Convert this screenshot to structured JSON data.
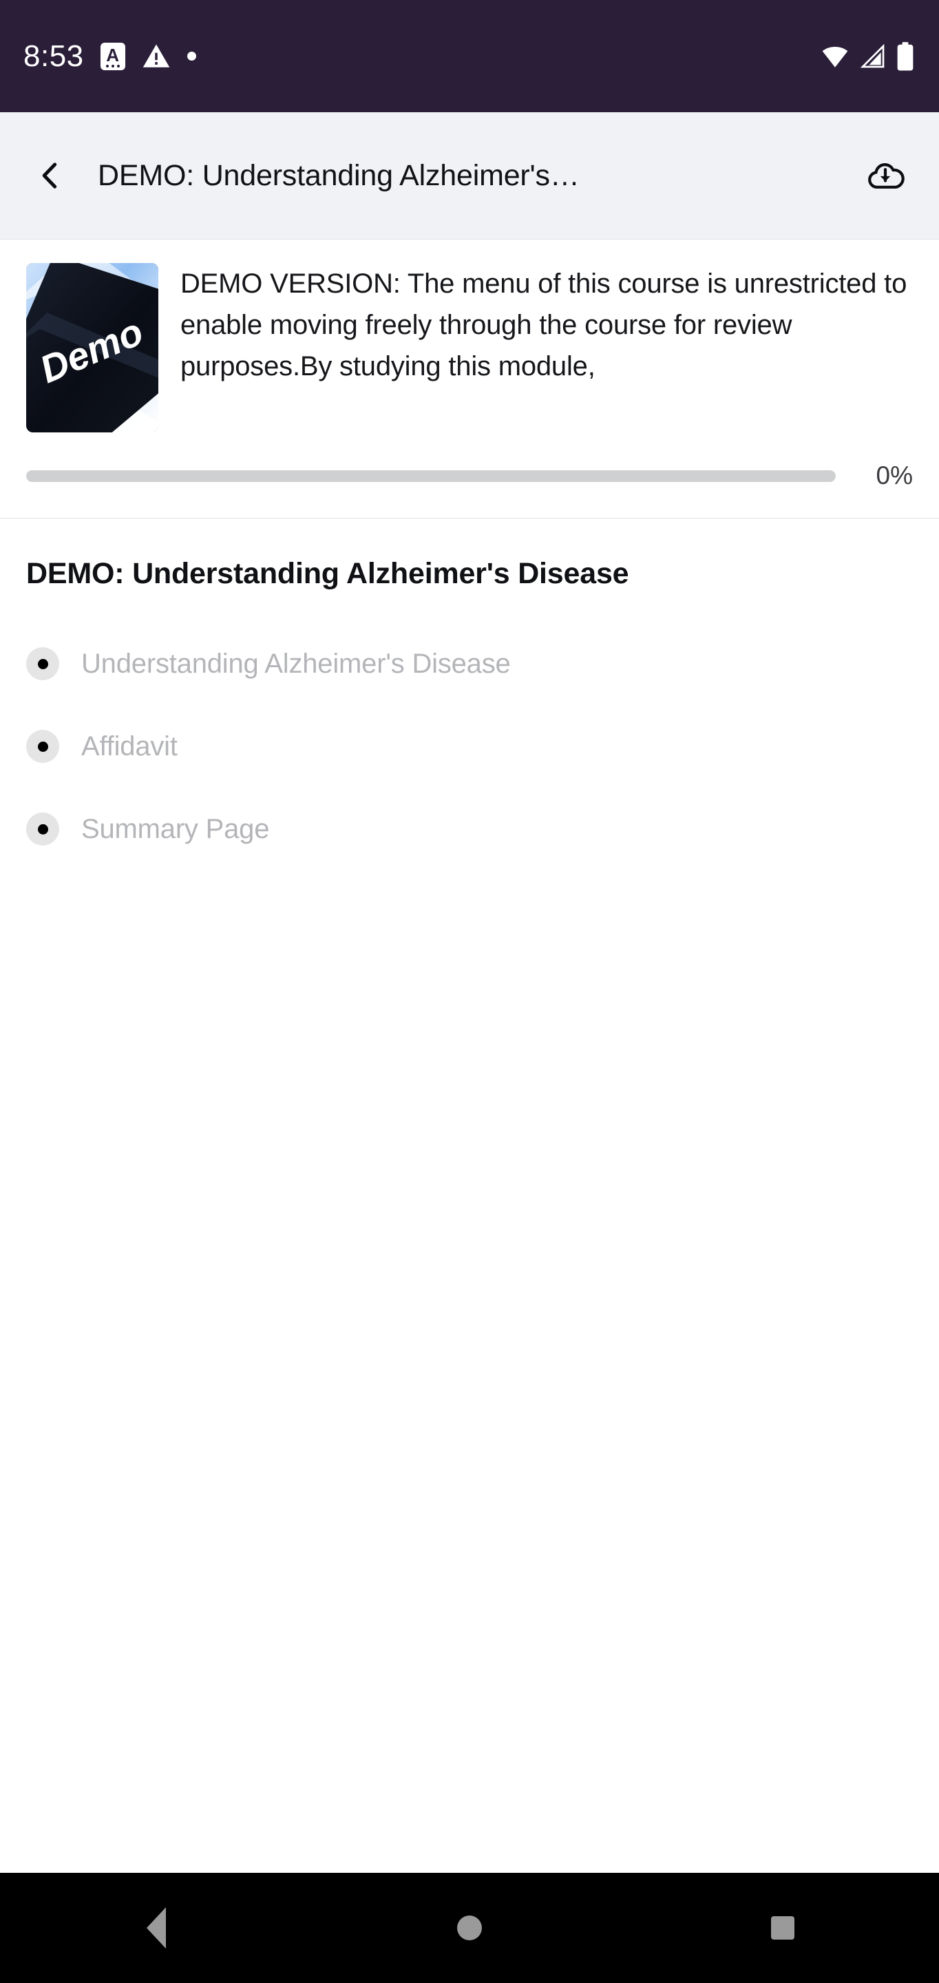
{
  "status_bar": {
    "time": "8:53",
    "background_color": "#2b1e39",
    "left_icons": [
      "a-badge-icon",
      "warning-triangle-icon",
      "dot-icon"
    ],
    "right_icons": [
      "wifi-icon",
      "cell-signal-icon",
      "battery-icon"
    ]
  },
  "app_bar": {
    "back_icon": "chevron-left-icon",
    "title": "DEMO: Understanding Alzheimer's…",
    "download_icon": "cloud-download-icon",
    "background_color": "#f1f2f5"
  },
  "course_card": {
    "thumbnail_alt": "Demo keyboard key",
    "thumbnail_text": "Demo",
    "description": "DEMO VERSION: The menu of this course is unrestricted to enable moving freely through the course for review purposes.By studying this module,",
    "progress": {
      "percent": 0,
      "label": "0%",
      "track_color": "#cfd0d2",
      "fill_color": "#6a2fa0"
    }
  },
  "section": {
    "title": "DEMO: Understanding Alzheimer's Disease",
    "lessons": [
      {
        "label": "Understanding Alzheimer's Disease",
        "status_icon": "dot-badge-icon"
      },
      {
        "label": "Affidavit",
        "status_icon": "dot-badge-icon"
      },
      {
        "label": "Summary Page",
        "status_icon": "dot-badge-icon"
      }
    ]
  },
  "nav_bar": {
    "background_color": "#000000",
    "buttons": [
      "back-triangle-icon",
      "home-circle-icon",
      "recents-square-icon"
    ]
  }
}
